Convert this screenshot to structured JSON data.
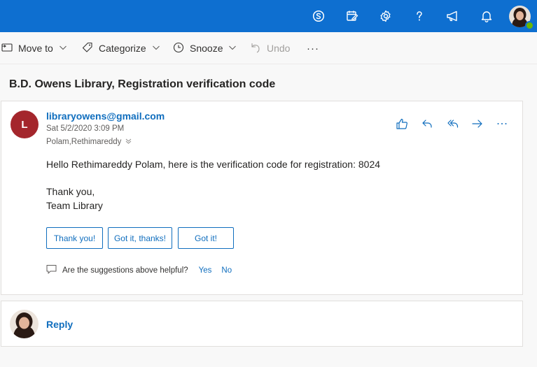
{
  "topbar": {
    "icons": [
      "skype-icon",
      "my-day-icon",
      "settings-gear-icon",
      "help-question-icon",
      "whats-new-megaphone-icon",
      "notifications-bell-icon"
    ],
    "presence_color": "#6bb700",
    "accent": "#0e6fd0"
  },
  "toolbar": {
    "move_to": "Move to",
    "categorize": "Categorize",
    "snooze": "Snooze",
    "undo": "Undo",
    "more": "···"
  },
  "message": {
    "subject": "B.D. Owens Library, Registration verification code",
    "sender_initial": "L",
    "sender_avatar_color": "#a4262c",
    "sender": "libraryowens@gmail.com",
    "date": "Sat 5/2/2020 3:09 PM",
    "recipients": "Polam,Rethimareddy",
    "body_line1": "Hello Rethimareddy Polam, here is the verification code for registration: 8024",
    "body_line2": "Thank you,",
    "body_line3": "Team Library",
    "quick_replies": [
      "Thank you!",
      "Got it, thanks!",
      "Got it!"
    ],
    "feedback_question": "Are the suggestions above helpful?",
    "feedback_yes": "Yes",
    "feedback_no": "No"
  },
  "reply": {
    "label": "Reply"
  }
}
